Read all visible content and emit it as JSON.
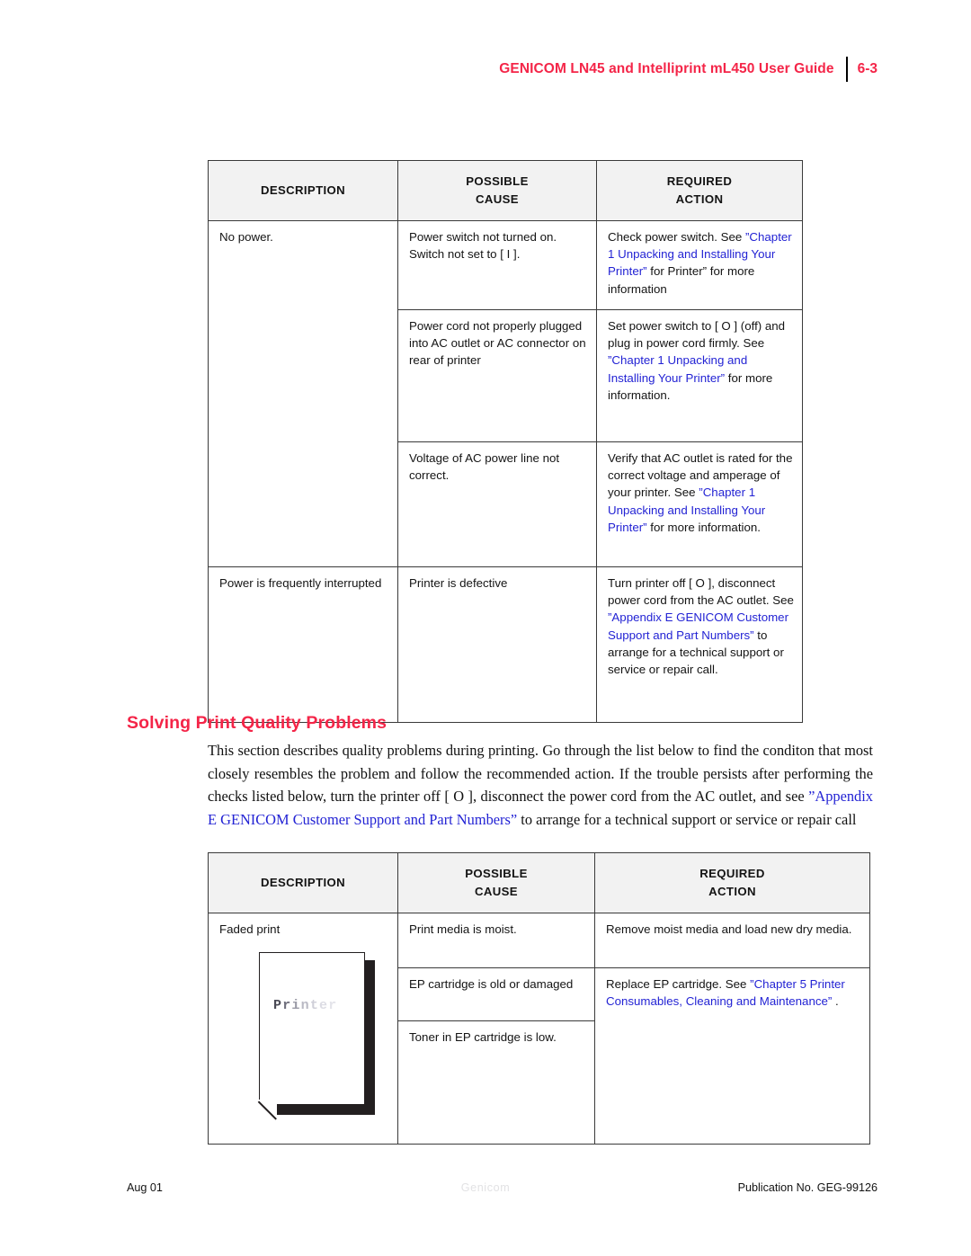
{
  "header": {
    "title": "GENICOM LN45 and Intelliprint mL450 User Guide",
    "page_number": "6-3",
    "title_color": "#f42548",
    "rule_color": "#000000"
  },
  "colors": {
    "heading_red": "#f42548",
    "xref_blue": "#2323d4",
    "table_header_bg": "#f2f2f2",
    "table_border": "#3a3a3a",
    "body_text": "#141414",
    "watermark_gray": "#e2e2e4"
  },
  "table_power_problems": {
    "columns": [
      "DESCRIPTION",
      "POSSIBLE\nCAUSE",
      "REQUIRED\nACTION"
    ],
    "rows": [
      {
        "description": "No power.",
        "cause": "Power switch not turned on. Switch not set to [ I ].",
        "action_pre": "Check power switch. See ",
        "action_link": "”Chapter 1 Unpacking and Installing Your Printer”",
        "action_post": " for Printer” for more information"
      },
      {
        "description": "",
        "cause": "Power cord not properly plugged into AC outlet or AC connector on rear of printer",
        "action_pre": "Set power switch to [ O ] (off) and plug in power cord firmly. See ",
        "action_link": "”Chapter 1 Unpacking and Installing Your Printer”",
        "action_post": " for more information."
      },
      {
        "description": "",
        "cause": "Voltage of AC power line not correct.",
        "action_pre": "Verify that AC outlet is rated for the correct voltage and amperage of your printer. See ",
        "action_link": "”Chapter 1 Unpacking and Installing Your Printer”",
        "action_post": " for more information."
      },
      {
        "description": "Power is frequently interrupted",
        "cause": "Printer is defective",
        "action_pre": "Turn printer off [ O ], disconnect power cord from the AC outlet. See ",
        "action_link": "”Appendix E GENICOM Customer Support and Part Numbers”",
        "action_post": " to arrange for a technical support or service or repair call."
      }
    ]
  },
  "section": {
    "heading": "Solving Print Quality Problems",
    "paragraph_pre": "This section describes quality problems during printing. Go through the list below to find the conditon that most closely resembles the problem and follow the recommended action. If the trouble persists after performing the checks listed below, turn the printer off [ O ], disconnect the power cord from the AC outlet, and see ",
    "paragraph_link": "”Appendix E GENICOM Customer Support and Part Numbers”",
    "paragraph_post": " to arrange for a technical support or service or repair call"
  },
  "table_print_quality": {
    "columns": [
      "DESCRIPTION",
      "POSSIBLE\nCAUSE",
      "REQUIRED\nACTION"
    ],
    "rows": [
      {
        "description": "Faded print",
        "cause": "Print media is moist.",
        "action_pre": "Remove moist media and load new dry media.",
        "action_link": "",
        "action_post": ""
      },
      {
        "description": "",
        "cause": "EP cartridge is old or damaged",
        "action_pre": "Replace EP cartridge. See ",
        "action_link": "”Chapter 5 Printer Consumables, Cleaning and Maintenance”",
        "action_post": " ."
      },
      {
        "description": "",
        "cause": "Toner in EP cartridge is low.",
        "action_pre": "",
        "action_link": "",
        "action_post": ""
      }
    ],
    "illustration": {
      "label": "Printer",
      "caption": "faded-print-sample-page"
    }
  },
  "footer": {
    "left": "Aug 01",
    "center": "Genicom",
    "right": "Publication No. GEG-99126"
  }
}
